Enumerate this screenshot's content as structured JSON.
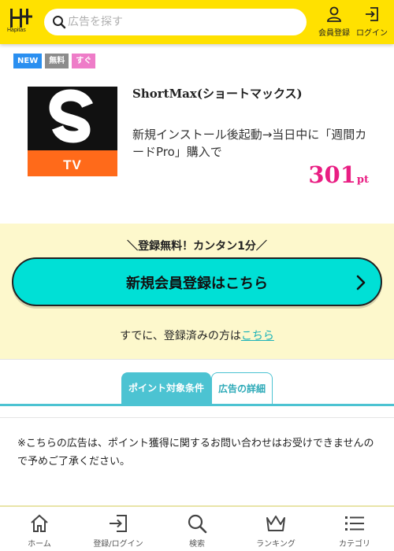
{
  "header": {
    "logo_text": "Hapitas",
    "search_placeholder": "広告を探す",
    "member_register_label": "会員登録",
    "login_label": "ログイン"
  },
  "tags": [
    {
      "label": "NEW",
      "color": "#2a8ff0"
    },
    {
      "label": "無料",
      "color": "#8c8c8c"
    },
    {
      "label": "すぐ",
      "color": "#ee7cc8"
    }
  ],
  "ad": {
    "image_text": "TV",
    "title": "ShortMax(ショートマックス)",
    "description": "新規インストール後起動→当日中に「週間カードPro」購入で",
    "points_value": "301",
    "points_unit": "pt"
  },
  "registration": {
    "catch": "＼登録無料！カンタン1分／",
    "button_label": "新規会員登録はこちら",
    "already_text": "すでに、登録済みの方は",
    "already_link": "こちら"
  },
  "tabs": {
    "conditions": "ポイント対象条件",
    "details": "広告の詳細"
  },
  "notice": "※こちらの広告は、ポイント獲得に関するお問い合わせはお受けできませんので予めご了承ください。",
  "bottom_nav": [
    {
      "label": "ホーム",
      "icon": "home-icon"
    },
    {
      "label": "登録/ログイン",
      "icon": "login-icon"
    },
    {
      "label": "検索",
      "icon": "search-icon"
    },
    {
      "label": "ランキング",
      "icon": "crown-icon"
    },
    {
      "label": "カテゴリ",
      "icon": "list-icon"
    }
  ],
  "colors": {
    "header": "#ffe100",
    "accent_teal": "#00e0d6",
    "points_pink": "#e91e83",
    "band": "#fdf8cc"
  }
}
